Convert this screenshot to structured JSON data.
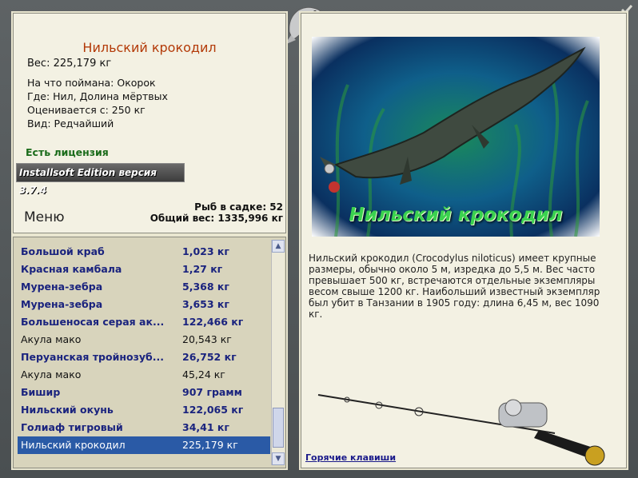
{
  "info": {
    "fish_title": "Нильский крокодил",
    "weight": "Вес: 225,179 кг",
    "caught_on": "На что поймана: Окорок",
    "where": "Где: Нил, Долина мёртвых",
    "valued": "Оценивается с: 250 кг",
    "kind": "Вид: Редчайший",
    "license": "Есть лицензия",
    "edition": "Installsoft Edition версия 3.7.4",
    "cage_count": "Рыб в садке: 52",
    "total_weight": "Общий вес: 1335,996 кг",
    "menu_label": "Меню"
  },
  "catch_list": [
    {
      "name": "Большой краб",
      "weight": "1,023 кг",
      "style": "bold"
    },
    {
      "name": "Красная камбала",
      "weight": "1,27 кг",
      "style": "bold"
    },
    {
      "name": "Мурена-зебра",
      "weight": "5,368 кг",
      "style": "bold"
    },
    {
      "name": "Мурена-зебра",
      "weight": "3,653 кг",
      "style": "bold"
    },
    {
      "name": "Большеносая серая ак...",
      "weight": "122,466 кг",
      "style": "bold"
    },
    {
      "name": "Акула мако",
      "weight": "20,543 кг",
      "style": "plain"
    },
    {
      "name": "Перуанская тройнозуб...",
      "weight": "26,752 кг",
      "style": "bold"
    },
    {
      "name": "Акула мако",
      "weight": "45,24 кг",
      "style": "plain"
    },
    {
      "name": "Бишир",
      "weight": "907 грамм",
      "style": "bold"
    },
    {
      "name": "Нильский окунь",
      "weight": "122,065 кг",
      "style": "bold"
    },
    {
      "name": "Голиаф тигровый",
      "weight": "34,41 кг",
      "style": "bold"
    },
    {
      "name": "Нильский крокодил",
      "weight": "225,179 кг",
      "style": "selected"
    }
  ],
  "right": {
    "picture_caption": "Нильский крокодил",
    "description": "Нильский крокодил (Crocodylus niloticus) имеет крупные размеры, обычно около 5 м, изредка до 5,5 м. Вес часто превышает 500 кг, встречаются отдельные экземпляры весом свыше 1200 кг. Наибольший известный экземпляр был убит в Танзании в 1905 году: длина 6,45 м, вес 1090 кг.",
    "hotkeys": "Горячие клавиши"
  },
  "icons": {
    "corner": "fish-logo-icon",
    "check": "check-icon",
    "scroll_up": "scroll-up-icon",
    "scroll_down": "scroll-down-icon"
  },
  "colors": {
    "title": "#b33a08",
    "license": "#1a6b1a",
    "list_bold": "#1a237e",
    "selected_row": "#2a5aa6",
    "caption": "#3bd24f"
  }
}
